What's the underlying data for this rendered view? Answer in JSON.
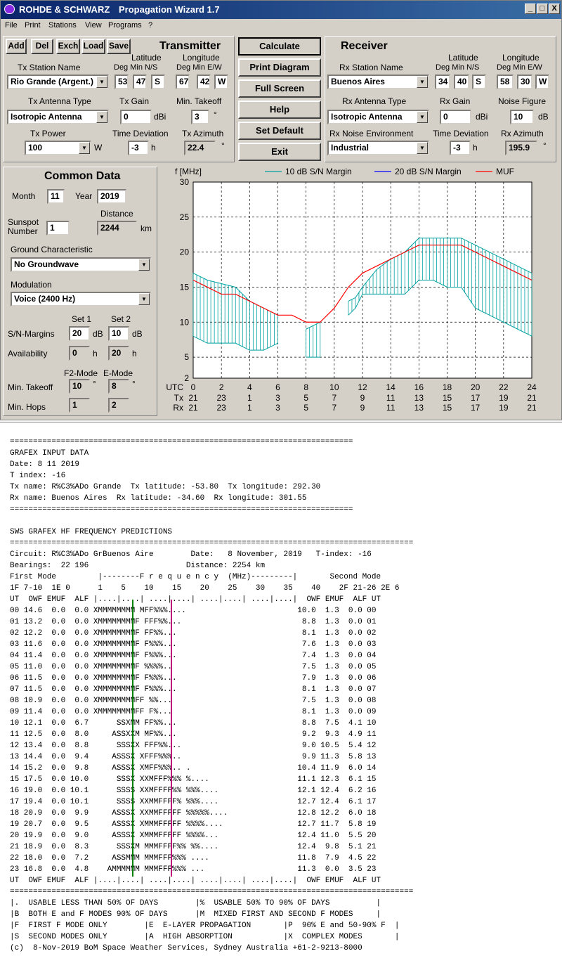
{
  "window": {
    "title_company": "ROHDE & SCHWARZ",
    "title_app": "Propagation Wizard  1.7",
    "controls": [
      "_",
      "□",
      "X"
    ]
  },
  "menu": [
    "File",
    "Print",
    "Stations",
    "View",
    "Programs",
    "?"
  ],
  "toolbar": [
    "Add",
    "Del",
    "Exch",
    "Load",
    "Save"
  ],
  "transmitter": {
    "heading": "Transmitter",
    "lat_label": "Latitude",
    "lon_label": "Longitude",
    "deg_min_ns": "Deg  Min  N/S",
    "deg_min_ew": "Deg   Min E/W",
    "station_label": "Tx Station Name",
    "station": "Rio Grande (Argent.)",
    "lat_deg": "53",
    "lat_min": "47",
    "lat_ns": "S",
    "lon_deg": "67",
    "lon_min": "42",
    "lon_ew": "W",
    "antenna_label": "Tx Antenna Type",
    "antenna": "Isotropic Antenna",
    "gain_label": "Tx Gain",
    "gain": "0",
    "gain_unit": "dBi",
    "takeoff_label": "Min. Takeoff",
    "takeoff": "3",
    "takeoff_unit": "°",
    "power_label": "Tx Power",
    "power": "100",
    "power_unit": "W",
    "timedev_label": "Time Deviation",
    "timedev": "-3",
    "timedev_unit": "h",
    "azimuth_label": "Tx Azimuth",
    "azimuth": "22.4",
    "azimuth_unit": "°"
  },
  "actions": [
    "Calculate",
    "Print Diagram",
    "Full Screen",
    "Help",
    "Set Default",
    "Exit"
  ],
  "receiver": {
    "heading": "Receiver",
    "lat_label": "Latitude",
    "lon_label": "Longitude",
    "deg_min_ns": "Deg  Min  N/S",
    "deg_min_ew": "Deg   Min E/W",
    "station_label": "Rx Station Name",
    "station": "Buenos Aires",
    "lat_deg": "34",
    "lat_min": "40",
    "lat_ns": "S",
    "lon_deg": "58",
    "lon_min": "30",
    "lon_ew": "W",
    "antenna_label": "Rx Antenna Type",
    "antenna": "Isotropic Antenna",
    "gain_label": "Rx Gain",
    "gain": "0",
    "gain_unit": "dBi",
    "noise_label": "Noise Figure",
    "noise": "10",
    "noise_unit": "dB",
    "env_label": "Rx Noise Environment",
    "env": "Industrial",
    "timedev_label": "Time Deviation",
    "timedev": "-3",
    "timedev_unit": "h",
    "azimuth_label": "Rx Azimuth",
    "azimuth": "195.9",
    "azimuth_unit": "°"
  },
  "common": {
    "heading": "Common Data",
    "month_label": "Month",
    "month": "11",
    "year_label": "Year",
    "year": "2019",
    "sunspot_label1": "Sunspot",
    "sunspot_label2": "Number",
    "sunspot": "1",
    "distance_label": "Distance",
    "distance": "2244",
    "distance_unit": "km",
    "ground_label": "Ground Characteristic",
    "ground": "No Groundwave",
    "modulation_label": "Modulation",
    "modulation": "Voice   (2400 Hz)",
    "set1_label": "Set 1",
    "set2_label": "Set 2",
    "sn_label": "S/N-Margins",
    "sn1": "20",
    "sn2": "10",
    "sn_unit": "dB",
    "avail_label": "Availability",
    "avail1": "0",
    "avail2": "20",
    "avail_unit": "h",
    "f2_label": "F2-Mode",
    "e_label": "E-Mode",
    "takeoff_label": "Min. Takeoff",
    "takeoff_f2": "10",
    "takeoff_e": "8",
    "takeoff_unit": "°",
    "hops_label": "Min. Hops",
    "hops_f2": "1",
    "hops_e": "2"
  },
  "colors": {
    "ui_gray": "#d4d0c8",
    "series_10db": "#00a0a0",
    "series_20db": "#0000ff",
    "muf": "#ff0000"
  },
  "chart_data": {
    "type": "area",
    "ylabel": "f [MHz]",
    "ylim": [
      2,
      30
    ],
    "y_ticks": [
      2,
      5,
      10,
      15,
      20,
      25,
      30
    ],
    "x": [
      0,
      1,
      2,
      3,
      4,
      5,
      6,
      7,
      8,
      9,
      10,
      11,
      12,
      13,
      14,
      15,
      16,
      17,
      18,
      19,
      20,
      21,
      22,
      23,
      24
    ],
    "x_ticks": [
      0,
      2,
      4,
      6,
      8,
      10,
      12,
      14,
      16,
      18,
      20,
      22,
      24
    ],
    "row_labels": [
      "UTC",
      "Tx",
      "Rx"
    ],
    "tx_ticks": [
      "21",
      "23",
      "1",
      "3",
      "5",
      "7",
      "9",
      "11",
      "13",
      "15",
      "17",
      "19",
      "21"
    ],
    "rx_ticks": [
      "21",
      "23",
      "1",
      "3",
      "5",
      "7",
      "9",
      "11",
      "13",
      "15",
      "17",
      "19",
      "21"
    ],
    "grid": true,
    "legend": [
      "10 dB S/N Margin",
      "20 dB S/N Margin",
      "MUF"
    ],
    "band_10db": [
      {
        "x": [
          0,
          1,
          2,
          3,
          4,
          5,
          6
        ],
        "upper": [
          17,
          16,
          15.5,
          15,
          13,
          12,
          11
        ],
        "lower": [
          8,
          7,
          7,
          7,
          6,
          6,
          7
        ]
      },
      {
        "x": [
          8,
          9
        ],
        "upper": [
          9,
          10
        ],
        "lower": [
          5,
          5
        ]
      },
      {
        "x": [
          11,
          11.5,
          12,
          13,
          14,
          15,
          16,
          17,
          18,
          19,
          20,
          21,
          22,
          23,
          24
        ],
        "upper": [
          13,
          13.5,
          15,
          17.5,
          19,
          20,
          22,
          22,
          22,
          22,
          21,
          20,
          19,
          18,
          17
        ],
        "lower": [
          11,
          12,
          14,
          14,
          14,
          14,
          16,
          16,
          15,
          15,
          12,
          11,
          10,
          9,
          8
        ]
      }
    ],
    "muf": {
      "x": [
        0,
        1,
        2,
        3,
        4,
        5,
        6,
        7,
        8,
        9,
        10,
        11,
        12,
        13,
        14,
        15,
        16,
        17,
        18,
        19,
        20,
        21,
        22,
        23,
        24
      ],
      "y": [
        16,
        15,
        14,
        14,
        13,
        12,
        11,
        11,
        10,
        10,
        12,
        15,
        17,
        18,
        19,
        20,
        21,
        21,
        21,
        21,
        20,
        19,
        18,
        17,
        16
      ]
    }
  },
  "report": {
    "rule": "==========================================================================",
    "rule_long": "=======================================================================================",
    "lines": [
      "GRAFEX INPUT DATA",
      "Date: 8 11 2019",
      "T index: -16",
      "Tx name: R%C3%ADo Grande  Tx latitude: -53.80  Tx longitude: 292.30",
      "Rx name: Buenos Aires  Rx latitude: -34.60  Rx longitude: 301.55",
      "",
      "SWS GRAFEX HF FREQUENCY PREDICTIONS",
      "Circuit: R%C3%ADo GrBuenos Aire        Date:   8 November, 2019   T-index: -16",
      "Bearings:  22 196                     Distance: 2254 km",
      "First Mode         |--------F r e q u e n c y  (MHz)---------|       Second Mode",
      "1F 7-10  1E 0      1    5    10    15    20    25    30    35    40    2F 21-26 2E 6",
      "UT  OWF EMUF  ALF |....|....| ....|....| ....|....| ....|....|  OWF EMUF  ALF UT",
      "00 14.6  0.0  0.0 XMMMMMMMM MFF%%%....                        10.0  1.3  0.0 00",
      "01 13.2  0.0  0.0 XMMMMMMMMF FFF%%...                          8.8  1.3  0.0 01",
      "02 12.2  0.0  0.0 XMMMMMMMMF FF%%...                           8.1  1.3  0.0 02",
      "03 11.6  0.0  0.0 XMMMMMMMMF F%%%...                           7.6  1.3  0.0 03",
      "04 11.4  0.0  0.0 XMMMMMMMMF F%%%...                           7.4  1.3  0.0 04",
      "05 11.0  0.0  0.0 XMMMMMMMMF %%%%..                            7.5  1.3  0.0 05",
      "06 11.5  0.0  0.0 XMMMMMMMMF F%%%...                           7.9  1.3  0.0 06",
      "07 11.5  0.0  0.0 XMMMMMMMMF F%%%...                           8.1  1.3  0.0 07",
      "08 10.9  0.0  0.0 XMMMMMMMMFF %%...                            7.5  1.3  0.0 08",
      "09 11.4  0.0  0.0 XMMMMMMMMFF F%...                            8.1  1.3  0.0 09",
      "10 12.1  0.0  6.7      SSXMM FF%%...                           8.8  7.5  4.1 10",
      "11 12.5  0.0  8.0     ASSXXM MF%%...                           9.2  9.3  4.9 11",
      "12 13.4  0.0  8.8      SSSXX FFF%%...                          9.0 10.5  5.4 12",
      "13 14.4  0.0  9.4     ASSSX XFFF%%%..                          9.9 11.3  5.8 13",
      "14 15.2  0.0  9.8     ASSSX XMFF%%%.. .                       10.4 11.9  6.0 14",
      "15 17.5  0.0 10.0      SSSX XXMFFF%%% %....                   11.1 12.3  6.1 15",
      "16 19.0  0.0 10.1      SSSS XXMFFFF%% %%%....                 12.1 12.4  6.2 16",
      "17 19.4  0.0 10.1      SSSS XXMMFFFF% %%%....                 12.7 12.4  6.1 17",
      "18 20.9  0.0  9.9     ASSSX XXMMFFFFF %%%%%....               12.8 12.2  6.0 18",
      "19 20.7  0.0  9.5     ASSSX XMMMFFFFF %%%%....                12.7 11.7  5.8 19",
      "20 19.9  0.0  9.0     ASSSX XMMMFFFFF %%%%...                 12.4 11.0  5.5 20",
      "21 18.9  0.0  8.3      SSSXM MMMFFFF%% %%....                 12.4  9.8  5.1 21",
      "22 18.0  0.0  7.2     ASSMMM MMMFFF%%% ....                   11.8  7.9  4.5 22",
      "23 16.8  0.0  4.8    AMMMMMM MMMFFF%%% ...                    11.3  0.0  3.5 23",
      "UT  OWF EMUF  ALF |....|....| ....|....| ....|....| ....|....|  OWF EMUF  ALF UT",
      "|.  USABLE LESS THAN 50% OF DAYS        |%  USABLE 50% TO 90% OF DAYS          |",
      "|B  BOTH E and F MODES 90% OF DAYS      |M  MIXED FIRST AND SECOND F MODES     |",
      "|F  FIRST F MODE ONLY        |E  E-LAYER PROPAGATION       |P  90% E and 50-90% F  |",
      "|S  SECOND MODES ONLY        |A  HIGH ABSORPTION           |X  COMPLEX MODES       |",
      "(c)  8-Nov-2019 BoM Space Weather Services, Sydney Australia +61-2-9213-8000"
    ]
  }
}
